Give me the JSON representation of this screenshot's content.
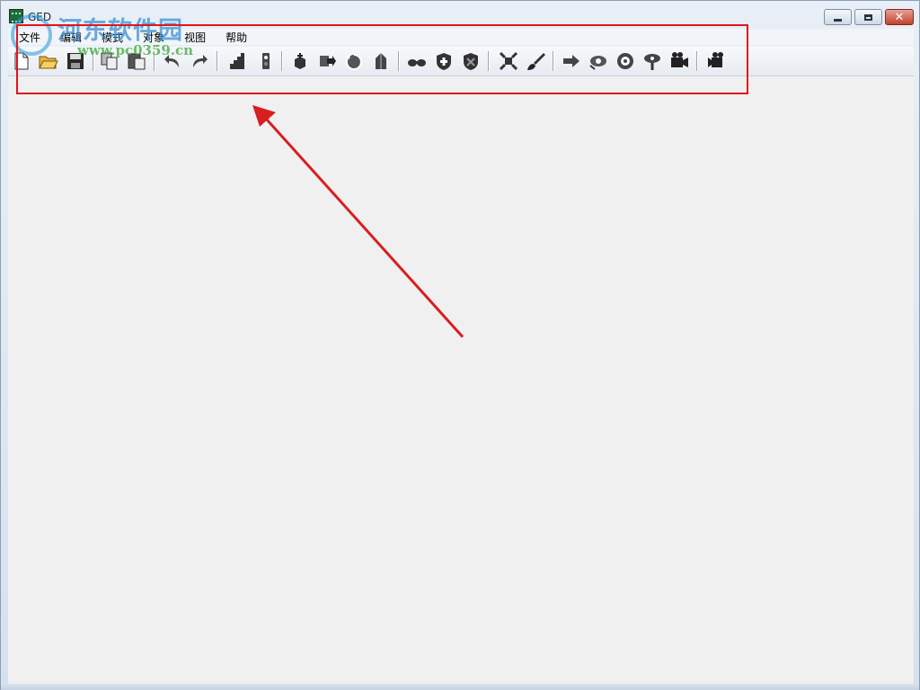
{
  "window": {
    "title": "GED",
    "controls": {
      "minimize_icon": "minimize-icon",
      "maximize_icon": "maximize-icon",
      "close_icon": "close-icon",
      "close_glyph": "✕"
    }
  },
  "menu": {
    "items": [
      {
        "label": "文件"
      },
      {
        "label": "编辑"
      },
      {
        "label": "模式"
      },
      {
        "label": "对象"
      },
      {
        "label": "视图"
      },
      {
        "label": "帮助"
      }
    ]
  },
  "toolbar": {
    "buttons": [
      {
        "icon": "new-file-icon"
      },
      {
        "icon": "open-folder-icon"
      },
      {
        "icon": "save-icon"
      },
      {
        "icon": "copy-icon"
      },
      {
        "icon": "paste-icon"
      },
      {
        "icon": "undo-icon"
      },
      {
        "icon": "redo-icon"
      },
      {
        "icon": "grid-stairs-icon"
      },
      {
        "icon": "slider-icon"
      },
      {
        "icon": "cube-arrow-icon"
      },
      {
        "icon": "shape-right-icon"
      },
      {
        "icon": "rotate-icon"
      },
      {
        "icon": "extrude-icon"
      },
      {
        "icon": "binoculars-icon"
      },
      {
        "icon": "shield-add-icon"
      },
      {
        "icon": "shield-edit-icon"
      },
      {
        "icon": "expand-icon"
      },
      {
        "icon": "brush-icon"
      },
      {
        "icon": "view-arrow-icon"
      },
      {
        "icon": "view-rotate-icon"
      },
      {
        "icon": "view-target-icon"
      },
      {
        "icon": "view-pin-icon"
      },
      {
        "icon": "camera-icon"
      },
      {
        "icon": "camera-record-icon"
      }
    ]
  },
  "annotation": {
    "highlight_color": "#e0141e",
    "arrow_color": "#d81e20"
  },
  "watermark": {
    "title": "河东软件园",
    "url": "www.pc0359.cn",
    "logo_icon": "watermark-logo-icon"
  }
}
